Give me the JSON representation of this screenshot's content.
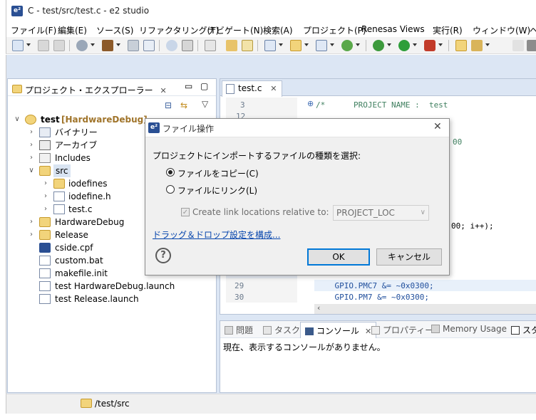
{
  "window": {
    "title": "C - test/src/test.c - e2 studio",
    "app_icon": "e2-studio-icon"
  },
  "menubar": {
    "items": [
      "ファイル(F)",
      "編集(E)",
      "ソース(S)",
      "リファクタリング(T)",
      "ナビゲート(N)",
      "検索(A)",
      "プロジェクト(P)",
      "Renesas Views",
      "実行(R)",
      "ウィンドウ(W)",
      "ヘ"
    ]
  },
  "explorer": {
    "tab_label": "プロジェクト・エクスプローラー",
    "project": {
      "name": "test",
      "config": "[HardwareDebug]"
    },
    "items": [
      {
        "label": "バイナリー"
      },
      {
        "label": "アーカイブ"
      },
      {
        "label": "Includes"
      },
      {
        "label": "src"
      },
      {
        "label": "iodefines"
      },
      {
        "label": "iodefine.h"
      },
      {
        "label": "test.c"
      },
      {
        "label": "HardwareDebug"
      },
      {
        "label": "Release"
      },
      {
        "label": "cside.cpf"
      },
      {
        "label": "custom.bat"
      },
      {
        "label": "makefile.init"
      },
      {
        "label": "test HardwareDebug.launch"
      },
      {
        "label": "test Release.launch"
      }
    ]
  },
  "editor": {
    "tab_label": "test.c",
    "lines": [
      {
        "num": "3",
        "code": "/*      PROJECT NAME :  test"
      },
      {
        "num": "12",
        "code": ""
      },
      {
        "num": "29",
        "code": "    GPIO.PMC7 &= ~0x0300;"
      },
      {
        "num": "30",
        "code": "    GPIO.PM7 &= ~0x0300;"
      }
    ],
    "partial_code": {
      "hidden_right_1": "00",
      "hidden_right_2": "00; i++);"
    }
  },
  "console": {
    "tabs": [
      "問題",
      "タスク",
      "コンソール",
      "プロパティー",
      "Memory Usage",
      "スタ"
    ],
    "message": "現在、表示するコンソールがありません。"
  },
  "statusbar": {
    "path": "/test/src"
  },
  "dialog": {
    "title": "ファイル操作",
    "prompt": "プロジェクトにインポートするファイルの種類を選択:",
    "option_copy": "ファイルをコピー(C)",
    "option_link": "ファイルにリンク(L)",
    "checkbox_label": "Create link locations relative to:",
    "combo_value": "PROJECT_LOC",
    "link_text": "ドラッグ＆ドロップ設定を構成...",
    "ok_label": "OK",
    "cancel_label": "キャンセル",
    "help_icon": "?"
  },
  "colors": {
    "workbench_bg": "#dce6f4",
    "project_config": "#a0742a",
    "link": "#0645ad",
    "default_button_border": "#0078d7",
    "macro_blue": "#1f4e9c"
  }
}
